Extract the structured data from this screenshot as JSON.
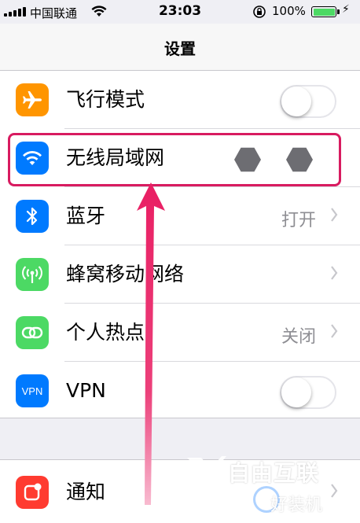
{
  "status_bar": {
    "carrier": "中国联通",
    "time": "23:03",
    "battery_percent": "100%",
    "battery_level": 1.0
  },
  "nav": {
    "title": "设置"
  },
  "settings_rows": [
    {
      "label": "飞行模式",
      "icon": "airplane-icon",
      "icon_color": "#ff9500",
      "control": "toggle",
      "toggle_on": false
    },
    {
      "label": "无线局域网",
      "icon": "wifi-icon",
      "icon_color": "#007aff",
      "control": "detail-redacted"
    },
    {
      "label": "蓝牙",
      "icon": "bluetooth-icon",
      "icon_color": "#007aff",
      "detail": "打开",
      "control": "chevron"
    },
    {
      "label": "蜂窝移动网络",
      "icon": "antenna-icon",
      "icon_color": "#4cd964",
      "control": "chevron"
    },
    {
      "label": "个人热点",
      "icon": "hotspot-icon",
      "icon_color": "#4cd964",
      "detail": "关闭",
      "control": "chevron"
    },
    {
      "label": "VPN",
      "icon": "vpn-icon",
      "icon_color": "#007aff",
      "icon_text": "VPN",
      "control": "toggle",
      "toggle_on": false
    },
    {
      "label": "通知",
      "icon": "notification-icon",
      "icon_color": "#ff3b30",
      "control": "chevron"
    }
  ],
  "watermark": {
    "brand": "自由互联",
    "sub": "好装机"
  },
  "colors": {
    "highlight": "#d81b60",
    "arrow": "#e91e63"
  }
}
